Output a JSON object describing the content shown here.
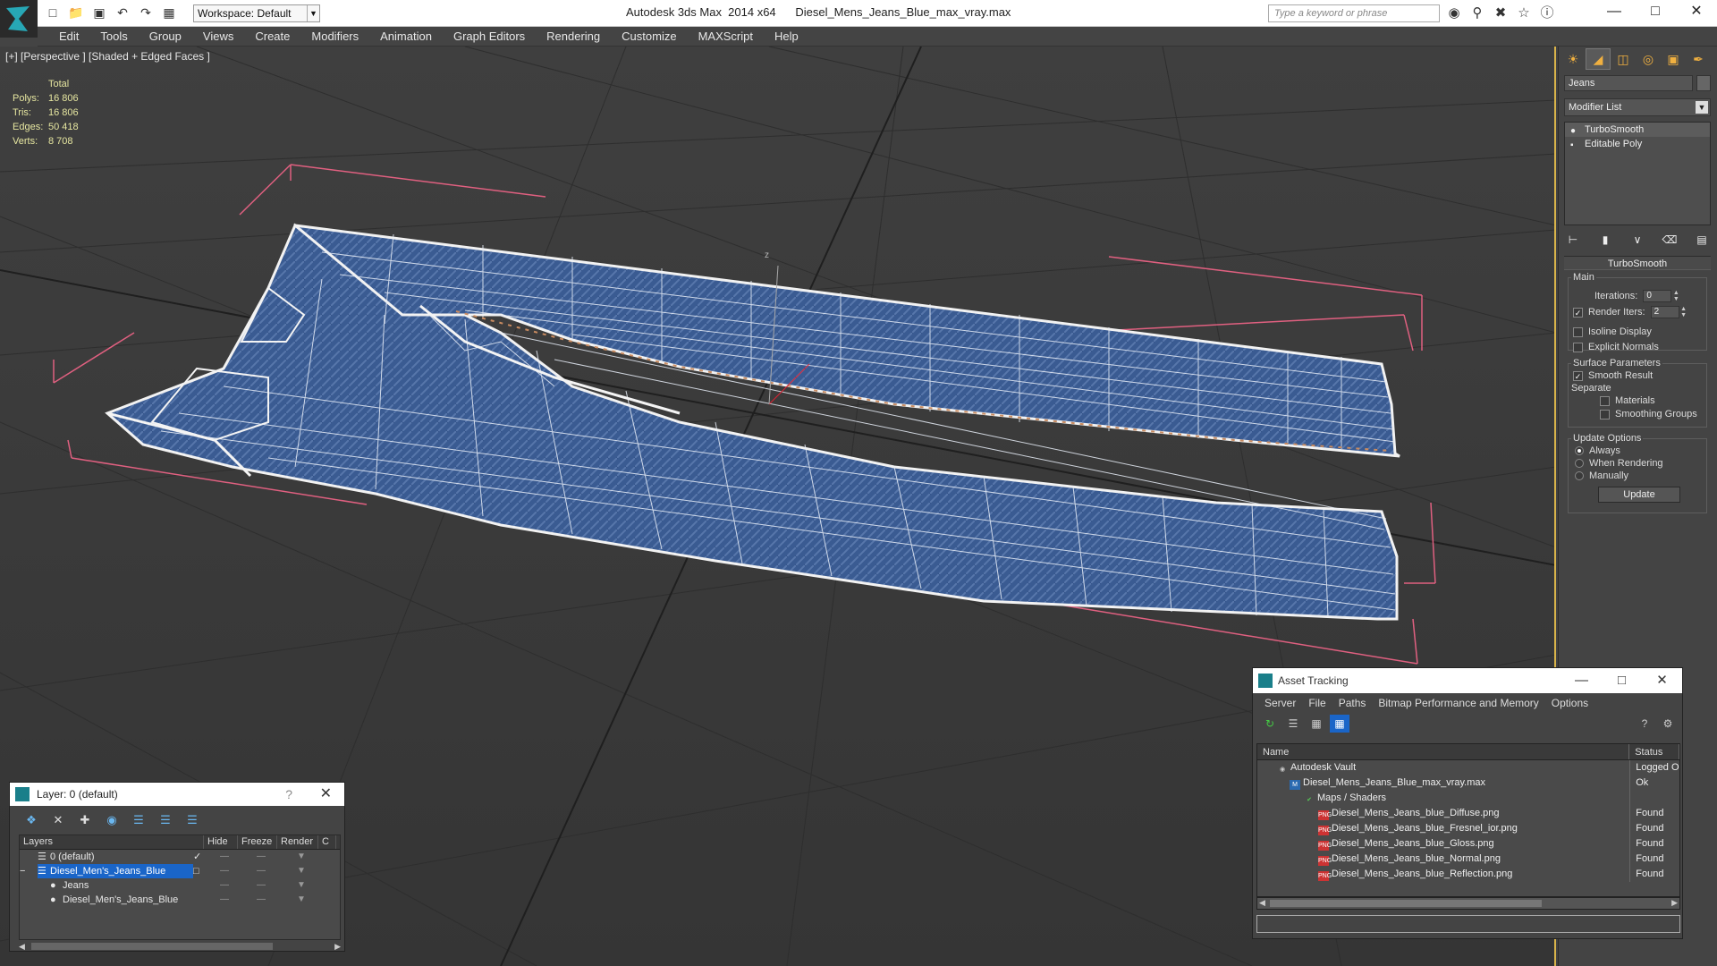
{
  "app": {
    "title": "Autodesk 3ds Max  2014 x64      Diesel_Mens_Jeans_Blue_max_vray.max",
    "workspace": "Workspace: Default",
    "search_placeholder": "Type a keyword or phrase"
  },
  "menu": [
    "Edit",
    "Tools",
    "Group",
    "Views",
    "Create",
    "Modifiers",
    "Animation",
    "Graph Editors",
    "Rendering",
    "Customize",
    "MAXScript",
    "Help"
  ],
  "viewport": {
    "label": "[+] [Perspective ] [Shaded + Edged Faces ]",
    "stats_header": "Total",
    "stats": [
      {
        "k": "Polys:",
        "v": "16 806"
      },
      {
        "k": "Tris:",
        "v": "16 806"
      },
      {
        "k": "Edges:",
        "v": "50 418"
      },
      {
        "k": "Verts:",
        "v": "8 708"
      }
    ],
    "axis_label": "z"
  },
  "command_panel": {
    "object_name": "Jeans",
    "modifier_list": "Modifier List",
    "stack": [
      "TurboSmooth",
      "Editable Poly"
    ],
    "rollout_title": "TurboSmooth",
    "main_label": "Main",
    "iterations_label": "Iterations:",
    "iterations_value": "0",
    "render_iters_label": "Render Iters:",
    "render_iters_value": "2",
    "isoline": "Isoline Display",
    "explicit_normals": "Explicit Normals",
    "surface_params": "Surface Parameters",
    "smooth_result": "Smooth Result",
    "separate": "Separate",
    "materials": "Materials",
    "smoothing_groups": "Smoothing Groups",
    "update_options": "Update Options",
    "always": "Always",
    "when_rendering": "When Rendering",
    "manually": "Manually",
    "update_button": "Update"
  },
  "layer_dialog": {
    "title": "Layer: 0 (default)",
    "columns": [
      "Layers",
      "Hide",
      "Freeze",
      "Render",
      "C"
    ],
    "rows": [
      "0 (default)",
      "Diesel_Men's_Jeans_Blue",
      "Jeans",
      "Diesel_Men's_Jeans_Blue"
    ]
  },
  "asset_dialog": {
    "title": "Asset Tracking",
    "menu": [
      "Server",
      "File",
      "Paths",
      "Bitmap Performance and Memory",
      "Options"
    ],
    "columns": [
      "Name",
      "Status"
    ],
    "rows": [
      {
        "name": "Autodesk Vault",
        "status": "Logged O"
      },
      {
        "name": "Diesel_Mens_Jeans_Blue_max_vray.max",
        "status": "Ok"
      },
      {
        "name": "Maps / Shaders",
        "status": ""
      },
      {
        "name": "Diesel_Mens_Jeans_blue_Diffuse.png",
        "status": "Found"
      },
      {
        "name": "Diesel_Mens_Jeans_blue_Fresnel_ior.png",
        "status": "Found"
      },
      {
        "name": "Diesel_Mens_Jeans_blue_Gloss.png",
        "status": "Found"
      },
      {
        "name": "Diesel_Mens_Jeans_blue_Normal.png",
        "status": "Found"
      },
      {
        "name": "Diesel_Mens_Jeans_blue_Reflection.png",
        "status": "Found"
      }
    ]
  },
  "colors": {
    "accent": "#d8b34a",
    "selection": "#1a65c8",
    "denim": "#3a5b92",
    "stats_text": "#e6e6a0"
  }
}
